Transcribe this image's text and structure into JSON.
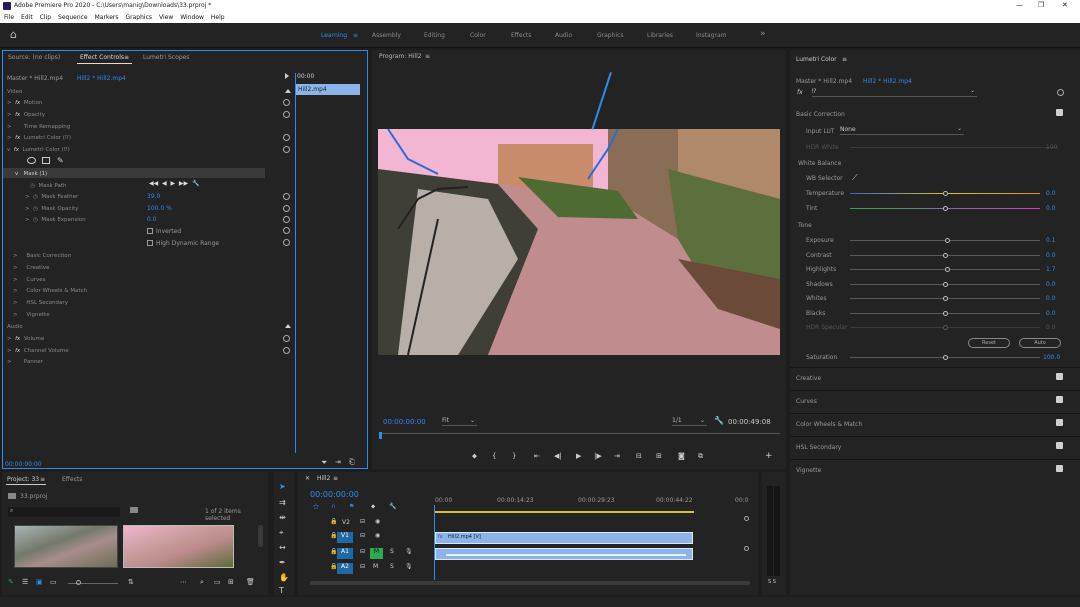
{
  "titlebar": {
    "title": "Adobe Premiere Pro 2020 - C:\\Users\\manig\\Downloads\\33.prproj *",
    "minimize": "—",
    "restore": "❐",
    "close": "✕"
  },
  "menu": [
    "File",
    "Edit",
    "Clip",
    "Sequence",
    "Markers",
    "Graphics",
    "View",
    "Window",
    "Help"
  ],
  "workspaces": {
    "home": "⌂",
    "items": [
      "Learning",
      "Assembly",
      "Editing",
      "Color",
      "Effects",
      "Audio",
      "Graphics",
      "Libraries",
      "Instagram"
    ],
    "more": "»",
    "active_menu": "≡"
  },
  "effect_controls": {
    "tabs": [
      "Source: (no clips)",
      "Effect Controls",
      "Lumetri Scopes"
    ],
    "tab_menu": "≡",
    "master": "Master * Hill2.mp4",
    "clip": "Hill2 * Hill2.mp4",
    "clip_bar": "Hill2.mp4",
    "rows": [
      {
        "label": "Video",
        "fx": "",
        "indent": 0
      },
      {
        "label": "Motion",
        "fx": "fx",
        "indent": 1
      },
      {
        "label": "Opacity",
        "fx": "fx",
        "indent": 1
      },
      {
        "label": "Time Remapping",
        "fx": "",
        "indent": 1
      },
      {
        "label": "Lumetri Color (⁉)",
        "fx": "fx",
        "indent": 1
      },
      {
        "label": "Lumetri Color (⁉)",
        "fx": "fx",
        "indent": 1
      }
    ],
    "mask_label": "Mask (1)",
    "mask_rows": [
      {
        "label": "Mask Path",
        "value": ""
      },
      {
        "label": "Mask Feather",
        "value": "39.0"
      },
      {
        "label": "Mask Opacity",
        "value": "100.0 %"
      },
      {
        "label": "Mask Expansion",
        "value": "0.0"
      }
    ],
    "inverted": "Inverted",
    "hdr": "High Dynamic Range",
    "sections": [
      "Basic Correction",
      "Creative",
      "Curves",
      "Color Wheels & Match",
      "HSL Secondary",
      "Vignette"
    ],
    "audio": "Audio",
    "audio_rows": [
      "Volume",
      "Channel Volume",
      "Panner"
    ],
    "timecode": "00:00:00:00",
    "ruler_start": "00:00"
  },
  "program": {
    "title": "Program: Hill2",
    "menu": "≡",
    "timecode": "00:00:00:00",
    "fit": "Fit",
    "ratio": "1/1",
    "duration": "00:00:49:08"
  },
  "project": {
    "tabs": [
      "Project: 33",
      "Effects"
    ],
    "filename": "33.prproj",
    "items_selected": "1 of 2 items selected"
  },
  "timeline": {
    "tab": "Hill2",
    "timecode": "00:00:00:00",
    "ruler": [
      "00:00",
      "00:00:14:23",
      "00:00:29:23",
      "00:00:44:22",
      "00:0"
    ],
    "tracks": [
      "V2",
      "V1",
      "A1",
      "A2"
    ],
    "clip_label": "Hill2.mp4 [V]"
  },
  "lumetri": {
    "title": "Lumetri Color",
    "menu": "≡",
    "master": "Master * Hill2.mp4",
    "clip": "Hill2 * Hill2.mp4",
    "fx": "fx",
    "fx_name": "⁉",
    "basic_correction": "Basic Correction",
    "input_lut_label": "Input LUT",
    "input_lut_value": "None",
    "hdr_white": "HDR White",
    "hdr_white_value": "100",
    "white_balance": "White Balance",
    "wb_selector": "WB Selector",
    "temperature": "Temperature",
    "temperature_value": "0.0",
    "tint": "Tint",
    "tint_value": "0.0",
    "tone": "Tone",
    "tone_rows": [
      {
        "label": "Exposure",
        "value": "0.1"
      },
      {
        "label": "Contrast",
        "value": "0.0"
      },
      {
        "label": "Highlights",
        "value": "1.7"
      },
      {
        "label": "Shadows",
        "value": "0.0"
      },
      {
        "label": "Whites",
        "value": "0.0"
      },
      {
        "label": "Blacks",
        "value": "0.0"
      },
      {
        "label": "HDR Specular",
        "value": "0.0"
      }
    ],
    "reset": "Reset",
    "auto": "Auto",
    "saturation": "Saturation",
    "saturation_value": "100.0",
    "sections": [
      "Creative",
      "Curves",
      "Color Wheels & Match",
      "HSL Secondary",
      "Vignette"
    ]
  },
  "colors": {
    "accent": "#2d8ceb",
    "clip_blue": "#8db4e8",
    "track_active": "#1f6aa5",
    "green": "#2fa84f"
  }
}
